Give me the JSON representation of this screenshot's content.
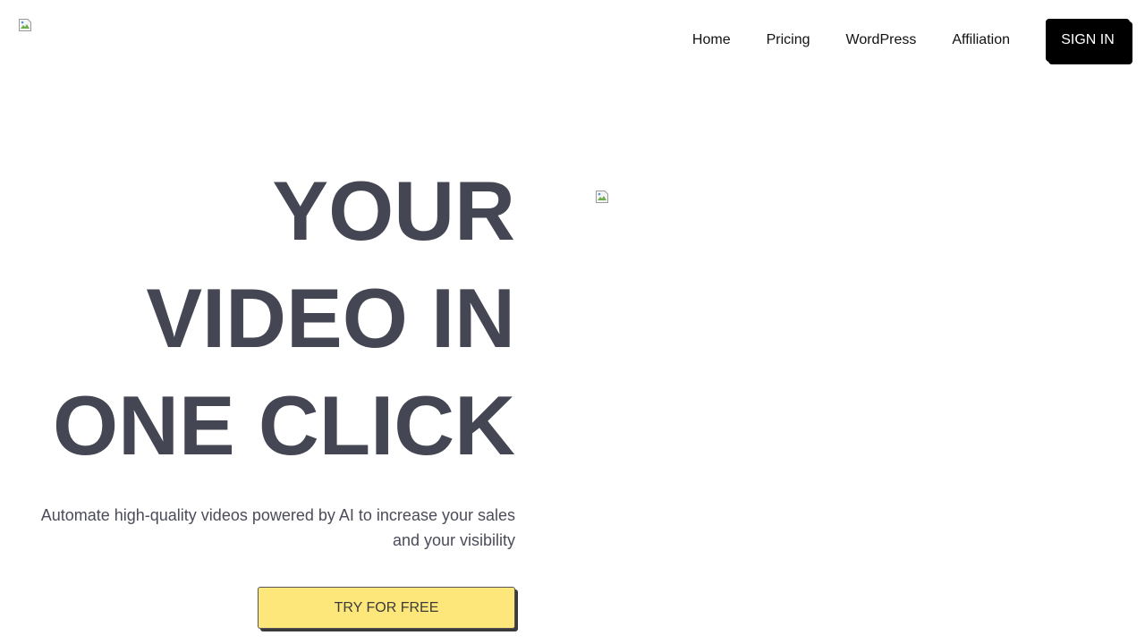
{
  "header": {
    "logo_icon": "broken-image-icon",
    "nav": [
      {
        "label": "Home"
      },
      {
        "label": "Pricing"
      },
      {
        "label": "WordPress"
      },
      {
        "label": "Affiliation"
      }
    ],
    "signin_label": "SIGN IN"
  },
  "hero": {
    "headline": [
      "YOUR",
      "VIDEO IN",
      "ONE CLICK"
    ],
    "subtitle": "Automate high-quality videos powered by AI to increase your sales and your visibility",
    "cta_label": "TRY FOR FREE",
    "image_icon": "broken-image-icon"
  },
  "colors": {
    "headline": "#454654",
    "cta_background": "#fde77b",
    "signin_background": "#000000"
  }
}
